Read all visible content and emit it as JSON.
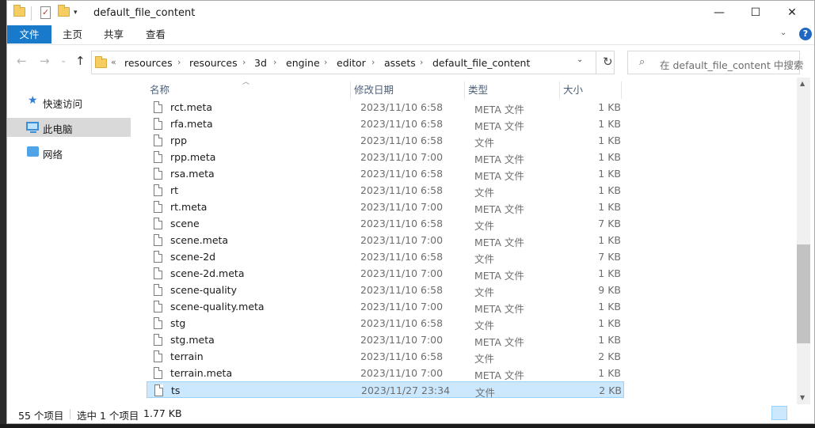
{
  "window": {
    "title": "default_file_content",
    "controls": {
      "minimize": "—",
      "maximize": "☐",
      "close": "✕"
    }
  },
  "ribbon": {
    "tabs": [
      "文件",
      "主页",
      "共享",
      "查看"
    ],
    "help": "?"
  },
  "address": {
    "overflow": "«",
    "crumbs": [
      "resources",
      "resources",
      "3d",
      "engine",
      "editor",
      "assets",
      "default_file_content"
    ],
    "separator": "›"
  },
  "search": {
    "placeholder": "在 default_file_content 中搜索"
  },
  "nav": {
    "items": [
      {
        "label": "快速访问",
        "icon": "star-icon",
        "selected": false
      },
      {
        "label": "此电脑",
        "icon": "computer-icon",
        "selected": true
      },
      {
        "label": "网络",
        "icon": "network-icon",
        "selected": false
      }
    ]
  },
  "columns": [
    "名称",
    "修改日期",
    "类型",
    "大小"
  ],
  "files": [
    {
      "name": "rct.meta",
      "date": "2023/11/10 6:58",
      "type": "META 文件",
      "size": "1 KB"
    },
    {
      "name": "rfa.meta",
      "date": "2023/11/10 6:58",
      "type": "META 文件",
      "size": "1 KB"
    },
    {
      "name": "rpp",
      "date": "2023/11/10 6:58",
      "type": "文件",
      "size": "1 KB"
    },
    {
      "name": "rpp.meta",
      "date": "2023/11/10 7:00",
      "type": "META 文件",
      "size": "1 KB"
    },
    {
      "name": "rsa.meta",
      "date": "2023/11/10 6:58",
      "type": "META 文件",
      "size": "1 KB"
    },
    {
      "name": "rt",
      "date": "2023/11/10 6:58",
      "type": "文件",
      "size": "1 KB"
    },
    {
      "name": "rt.meta",
      "date": "2023/11/10 7:00",
      "type": "META 文件",
      "size": "1 KB"
    },
    {
      "name": "scene",
      "date": "2023/11/10 6:58",
      "type": "文件",
      "size": "7 KB"
    },
    {
      "name": "scene.meta",
      "date": "2023/11/10 7:00",
      "type": "META 文件",
      "size": "1 KB"
    },
    {
      "name": "scene-2d",
      "date": "2023/11/10 6:58",
      "type": "文件",
      "size": "7 KB"
    },
    {
      "name": "scene-2d.meta",
      "date": "2023/11/10 7:00",
      "type": "META 文件",
      "size": "1 KB"
    },
    {
      "name": "scene-quality",
      "date": "2023/11/10 6:58",
      "type": "文件",
      "size": "9 KB"
    },
    {
      "name": "scene-quality.meta",
      "date": "2023/11/10 7:00",
      "type": "META 文件",
      "size": "1 KB"
    },
    {
      "name": "stg",
      "date": "2023/11/10 6:58",
      "type": "文件",
      "size": "1 KB"
    },
    {
      "name": "stg.meta",
      "date": "2023/11/10 7:00",
      "type": "META 文件",
      "size": "1 KB"
    },
    {
      "name": "terrain",
      "date": "2023/11/10 6:58",
      "type": "文件",
      "size": "2 KB"
    },
    {
      "name": "terrain.meta",
      "date": "2023/11/10 7:00",
      "type": "META 文件",
      "size": "1 KB"
    },
    {
      "name": "ts",
      "date": "2023/11/27 23:34",
      "type": "文件",
      "size": "2 KB",
      "selected": true
    }
  ],
  "status": {
    "count": "55 个项目",
    "selection": "选中 1 个项目",
    "size": "1.77 KB"
  },
  "colors": {
    "accent": "#1979ca",
    "selection": "#cce8ff",
    "selection_border": "#99d1ff"
  }
}
